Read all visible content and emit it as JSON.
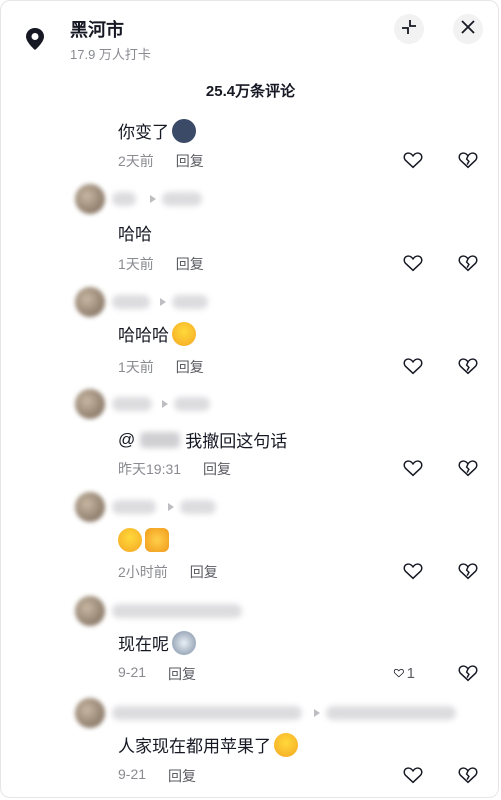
{
  "header": {
    "city": "黑河市",
    "checkins": "17.9 万人打卡",
    "location_icon": "location-pin-icon",
    "collapse_icon": "collapse-icon",
    "close_icon": "close-icon"
  },
  "comments_title": "25.4万条评论",
  "comments": [
    {
      "text": "你变了",
      "emoji": [
        "cool-emoji"
      ],
      "time": "2天前",
      "reply": "回复",
      "likes": ""
    },
    {
      "text": "哈哈",
      "emoji": [],
      "time": "1天前",
      "reply": "回复",
      "likes": ""
    },
    {
      "text": "哈哈哈",
      "emoji": [
        "laugh-cry-emoji"
      ],
      "time": "1天前",
      "reply": "回复",
      "likes": ""
    },
    {
      "text_prefix": "@",
      "text": "我撤回这句话",
      "emoji": [],
      "time": "昨天19:31",
      "reply": "回复",
      "likes": ""
    },
    {
      "text": "",
      "emoji": [
        "laugh-cry-emoji",
        "thumbs-up-emoji"
      ],
      "time": "2小时前",
      "reply": "回复",
      "likes": ""
    },
    {
      "text": "现在呢",
      "emoji": [
        "husky-emoji"
      ],
      "time": "9-21",
      "reply": "回复",
      "likes": "1"
    },
    {
      "text": "人家现在都用苹果了",
      "emoji": [
        "laugh-cry-emoji"
      ],
      "time": "9-21",
      "reply": "回复",
      "likes": ""
    }
  ]
}
